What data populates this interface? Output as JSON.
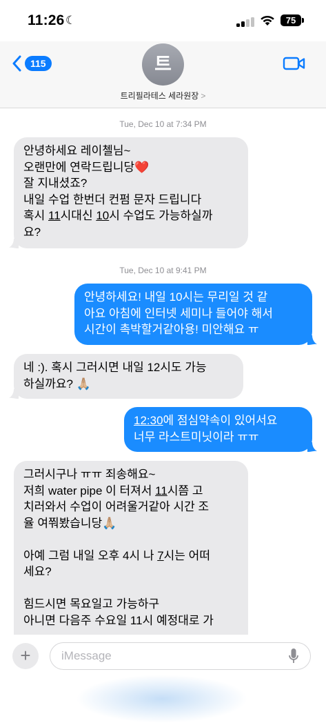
{
  "status_bar": {
    "time": "11:26",
    "battery": "75"
  },
  "header": {
    "back_count": "115",
    "avatar_initial": "트",
    "contact_name": "트리필라테스 세라원장",
    "name_chevron": ">"
  },
  "thread": {
    "timestamp_1": "Tue, Dec 10 at 7:34 PM",
    "msg_1": {
      "before": "안녕하세요 레이첼님~\n오랜만에 연락드립니당❤️\n잘 지내셨죠?\n내일 수업 한번더 컨펌 문자 드립니다\n혹시 ",
      "t1": "11",
      "mid": "시대신 ",
      "t2": "10",
      "after": "시 수업도 가능하실까\n요?"
    },
    "timestamp_2": "Tue, Dec 10 at 9:41 PM",
    "msg_2": "안녕하세요! 내일 10시는 무리일 것 같\n아요 아침에 인터넷 세미나 들어야 해서\n시간이 촉박할거같아용! 미안해요 ㅠ",
    "msg_3": "네 :). 혹시 그러시면 내일 12시도 가능\n하실까요? 🙏🏼",
    "msg_4": {
      "t1": "12:30",
      "after": "에 점심약속이 있어서요\n너무 라스트미닛이라 ㅠㅠ"
    },
    "msg_5": {
      "l1": "그러시구나 ㅠㅠ 죄송해요~\n저희 water pipe 이 터져서 ",
      "t1": "11",
      "l2": "시쯤 고\n치러와서 수업이 어려울거같아 시간 조\n율 여쭤봤습니당🙏🏼\n\n아예 그럼 내일 오후 4시 나 ",
      "t2": "7",
      "l3": "시는 어떠\n세요?\n\n힘드시면 목요일고 가능하구\n아니면 다음주 수요일 11시 예정대로 가"
    }
  },
  "input": {
    "plus": "+",
    "placeholder": "iMessage"
  },
  "colors": {
    "outgoing": "#1a8cff",
    "incoming": "#e9e9eb",
    "accent": "#0b7cff"
  },
  "icons": [
    "moon-icon",
    "cellular-signal-icon",
    "wifi-icon",
    "battery-icon",
    "back-chevron-icon",
    "video-call-icon",
    "plus-icon",
    "microphone-icon"
  ]
}
